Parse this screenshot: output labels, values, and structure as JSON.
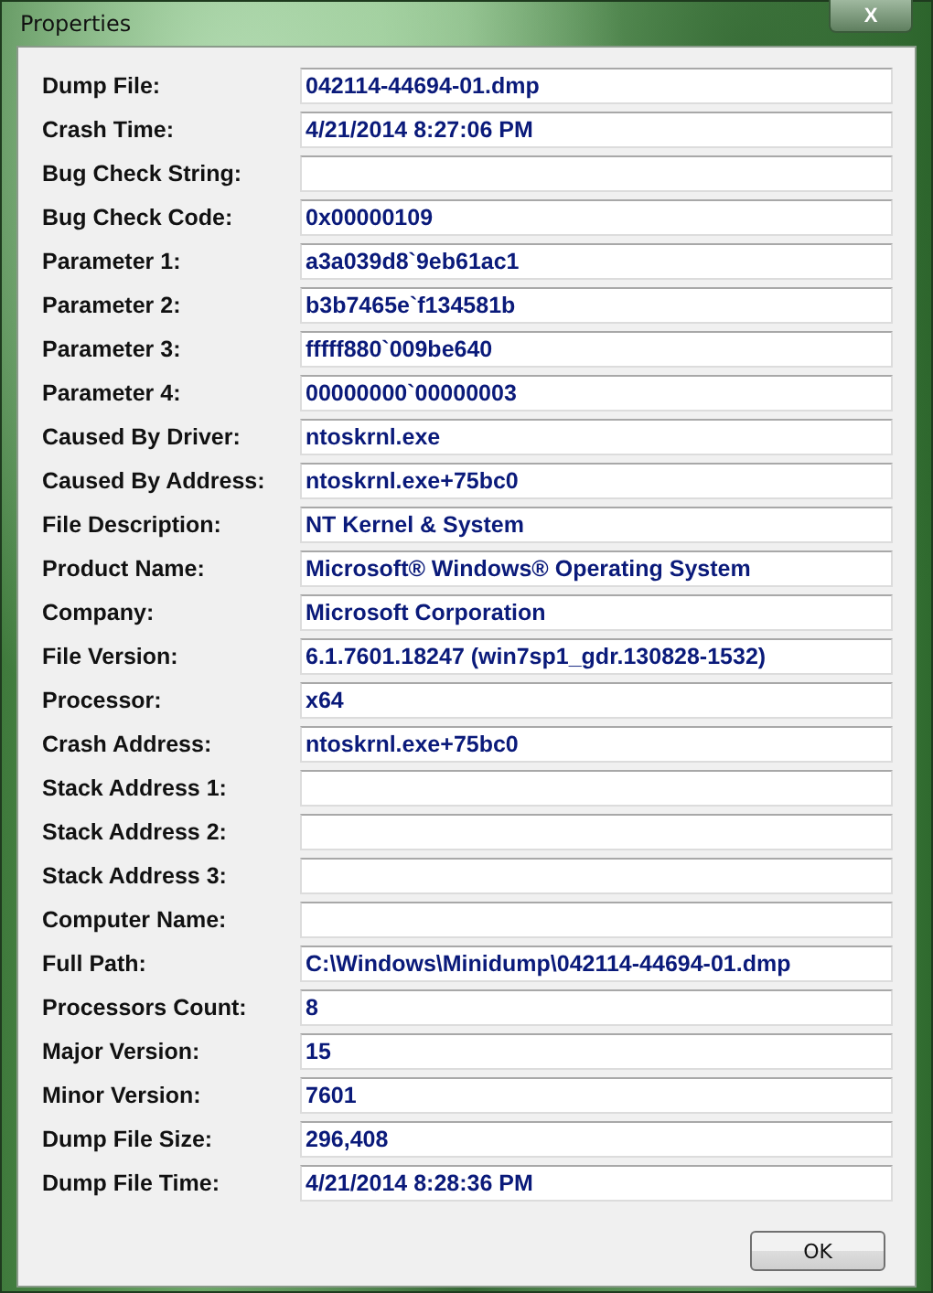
{
  "window": {
    "title": "Properties",
    "close": "X"
  },
  "fields": [
    {
      "label": "Dump File:",
      "value": "042114-44694-01.dmp"
    },
    {
      "label": "Crash Time:",
      "value": "4/21/2014 8:27:06 PM"
    },
    {
      "label": "Bug Check String:"
    },
    {
      "label": "Bug Check Code:",
      "value": "0x00000109"
    },
    {
      "label": "Parameter 1:",
      "value": "a3a039d8`9eb61ac1"
    },
    {
      "label": "Parameter 2:",
      "value": "b3b7465e`f134581b"
    },
    {
      "label": "Parameter 3:",
      "value": "fffff880`009be640"
    },
    {
      "label": "Parameter 4:",
      "value": "00000000`00000003"
    },
    {
      "label": "Caused By Driver:",
      "value": "ntoskrnl.exe"
    },
    {
      "label": "Caused By Address:",
      "value": "ntoskrnl.exe+75bc0"
    },
    {
      "label": "File Description:",
      "value": "NT Kernel & System"
    },
    {
      "label": "Product Name:",
      "value": "Microsoft® Windows® Operating System"
    },
    {
      "label": "Company:",
      "value": "Microsoft Corporation"
    },
    {
      "label": "File Version:",
      "value": "6.1.7601.18247 (win7sp1_gdr.130828-1532)"
    },
    {
      "label": "Processor:",
      "value": "x64"
    },
    {
      "label": "Crash Address:",
      "value": "ntoskrnl.exe+75bc0"
    },
    {
      "label": "Stack Address 1:"
    },
    {
      "label": "Stack Address 2:"
    },
    {
      "label": "Stack Address 3:"
    },
    {
      "label": "Computer Name:"
    },
    {
      "label": "Full Path:",
      "value": "C:\\Windows\\Minidump\\042114-44694-01.dmp"
    },
    {
      "label": "Processors Count:",
      "value": "8"
    },
    {
      "label": "Major Version:",
      "value": "15"
    },
    {
      "label": "Minor Version:",
      "value": "7601"
    },
    {
      "label": "Dump File Size:",
      "value": "296,408"
    },
    {
      "label": "Dump File Time:",
      "value": "4/21/2014 8:28:36 PM"
    }
  ],
  "buttons": [
    "OK"
  ]
}
